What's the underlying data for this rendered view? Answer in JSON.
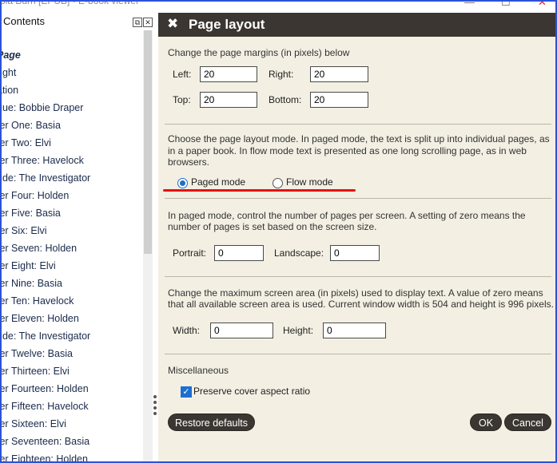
{
  "window": {
    "title_fragment": "ola Burn [EPUB] - E-book viewer",
    "minimize_icon": "minimize-icon",
    "maximize_icon": "maximize-icon",
    "close_icon": "close-icon"
  },
  "toc": {
    "title": "Contents",
    "items": [
      {
        "label": "Page",
        "heading": true
      },
      {
        "label": "right"
      },
      {
        "label": "ation"
      },
      {
        "label": "gue: Bobbie Draper"
      },
      {
        "label": "ter One: Basia"
      },
      {
        "label": "ter Two: Elvi"
      },
      {
        "label": "ter Three: Havelock"
      },
      {
        "label": "ude: The Investigator"
      },
      {
        "label": "ter Four: Holden"
      },
      {
        "label": "ter Five: Basia"
      },
      {
        "label": "ter Six: Elvi"
      },
      {
        "label": "ter Seven: Holden"
      },
      {
        "label": "ter Eight: Elvi"
      },
      {
        "label": "ter Nine: Basia"
      },
      {
        "label": "ter Ten: Havelock"
      },
      {
        "label": "ter Eleven: Holden"
      },
      {
        "label": "ude: The Investigator"
      },
      {
        "label": "ter Twelve: Basia"
      },
      {
        "label": "ter Thirteen: Elvi"
      },
      {
        "label": "ter Fourteen: Holden"
      },
      {
        "label": "ter Fifteen: Havelock"
      },
      {
        "label": "ter Sixteen: Elvi"
      },
      {
        "label": "ter Seventeen: Basia"
      },
      {
        "label": "ter Eighteen: Holden"
      }
    ]
  },
  "dialog": {
    "title": "Page layout",
    "close_glyph": "✖",
    "margins": {
      "intro": "Change the page margins (in pixels) below",
      "left_label": "Left:",
      "left_value": "20",
      "right_label": "Right:",
      "right_value": "20",
      "top_label": "Top:",
      "top_value": "20",
      "bottom_label": "Bottom:",
      "bottom_value": "20"
    },
    "mode": {
      "intro_line1": "Choose the page layout mode. In paged mode, the text is split up into individual pages, as",
      "intro_line2": "in a paper book. In flow mode text is presented as one long scrolling page, as in web",
      "intro_line3": "browsers.",
      "paged_label": "Paged mode",
      "flow_label": "Flow mode",
      "selected": "paged"
    },
    "pages": {
      "intro_line1": "In paged mode, control the number of pages per screen. A setting of zero means the",
      "intro_line2": "number of pages is set based on the screen size.",
      "portrait_label": "Portrait:",
      "portrait_value": "0",
      "landscape_label": "Landscape:",
      "landscape_value": "0"
    },
    "screen": {
      "intro_line1": "Change the maximum screen area (in pixels) used to display text. A value of zero means",
      "intro_line2": "that all available screen area is used. Current window width is 504 and height is 996 pixels.",
      "width_label": "Width:",
      "width_value": "0",
      "height_label": "Height:",
      "height_value": "0"
    },
    "misc": {
      "title": "Miscellaneous",
      "preserve_label": "Preserve cover aspect ratio",
      "preserve_checked": true
    },
    "buttons": {
      "restore": "Restore defaults",
      "ok": "OK",
      "cancel": "Cancel"
    }
  },
  "colors": {
    "accent": "#1c6fd0",
    "header_bg": "#3b3632",
    "dialog_bg": "#f3efe3",
    "annotation": "#e81010",
    "window_border": "#2a52d8"
  }
}
